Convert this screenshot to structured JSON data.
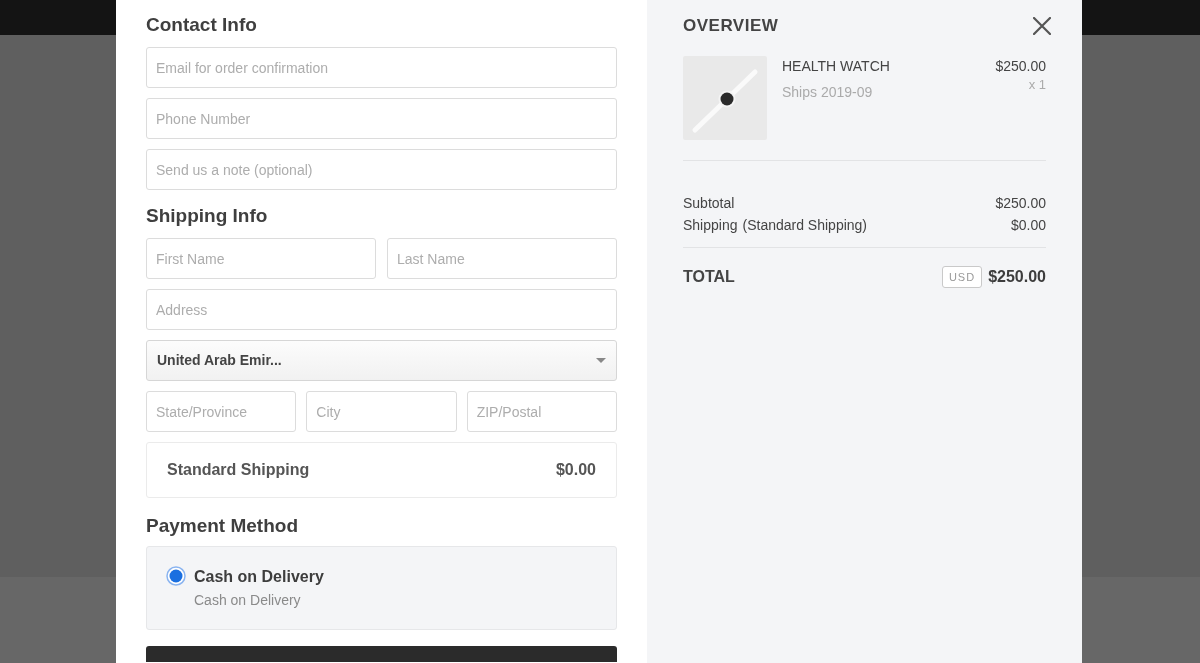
{
  "contact_info": {
    "heading": "Contact Info",
    "fields": [
      {
        "placeholder": "Email for order confirmation"
      },
      {
        "placeholder": "Phone Number"
      },
      {
        "placeholder": "Send us a note (optional)"
      }
    ]
  },
  "shipping_info": {
    "heading": "Shipping Info",
    "name_fields": [
      {
        "placeholder": "First Name"
      },
      {
        "placeholder": "Last Name"
      }
    ],
    "address_field": {
      "placeholder": "Address"
    },
    "country_select": {
      "value": "United Arab Emir..."
    },
    "region_fields": [
      {
        "placeholder": "State/Province"
      },
      {
        "placeholder": "City"
      },
      {
        "placeholder": "ZIP/Postal"
      }
    ],
    "shipping_option": {
      "label": "Standard Shipping",
      "price": "$0.00"
    }
  },
  "payment_method": {
    "heading": "Payment Method",
    "options": [
      {
        "label": "Cash on Delivery",
        "description": "Cash on Delivery",
        "selected": true
      }
    ]
  },
  "overview": {
    "title": "OVERVIEW",
    "items": [
      {
        "name": "HEALTH WATCH",
        "ships": "Ships 2019-09",
        "price": "$250.00",
        "quantity": "x 1"
      }
    ],
    "summary": [
      {
        "label": "Subtotal",
        "value": "$250.00"
      },
      {
        "label": "Shipping",
        "detail": "(Standard Shipping)",
        "value": "$0.00"
      }
    ],
    "total": {
      "label": "TOTAL",
      "currency": "USD",
      "value": "$250.00"
    }
  }
}
